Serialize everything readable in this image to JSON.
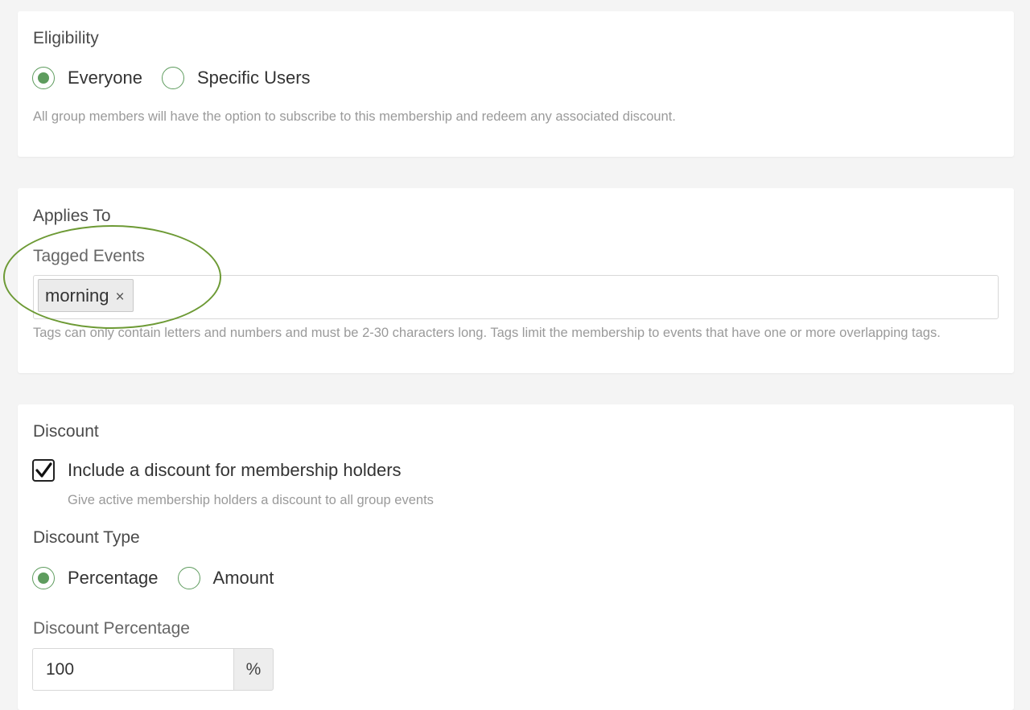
{
  "eligibility": {
    "title": "Eligibility",
    "options": [
      "Everyone",
      "Specific Users"
    ],
    "selected": "Everyone",
    "help": "All group members will have the option to subscribe to this membership and redeem any associated discount."
  },
  "applies_to": {
    "title": "Applies To",
    "field_label": "Tagged Events",
    "tags": [
      "morning"
    ],
    "remove_glyph": "×",
    "help": "Tags can only contain letters and numbers and must be 2-30 characters long. Tags limit the membership to events that have one or more overlapping tags."
  },
  "discount": {
    "title": "Discount",
    "checkbox_label": "Include a discount for membership holders",
    "checkbox_checked": true,
    "checkbox_help": "Give active membership holders a discount to all group events",
    "type_title": "Discount Type",
    "type_options": [
      "Percentage",
      "Amount"
    ],
    "type_selected": "Percentage",
    "percentage_label": "Discount Percentage",
    "percentage_value": "100",
    "percentage_unit": "%"
  },
  "colors": {
    "accent_green": "#5e9c5e",
    "highlight_ellipse": "#6d9a35",
    "background": "#f4f4f4"
  }
}
